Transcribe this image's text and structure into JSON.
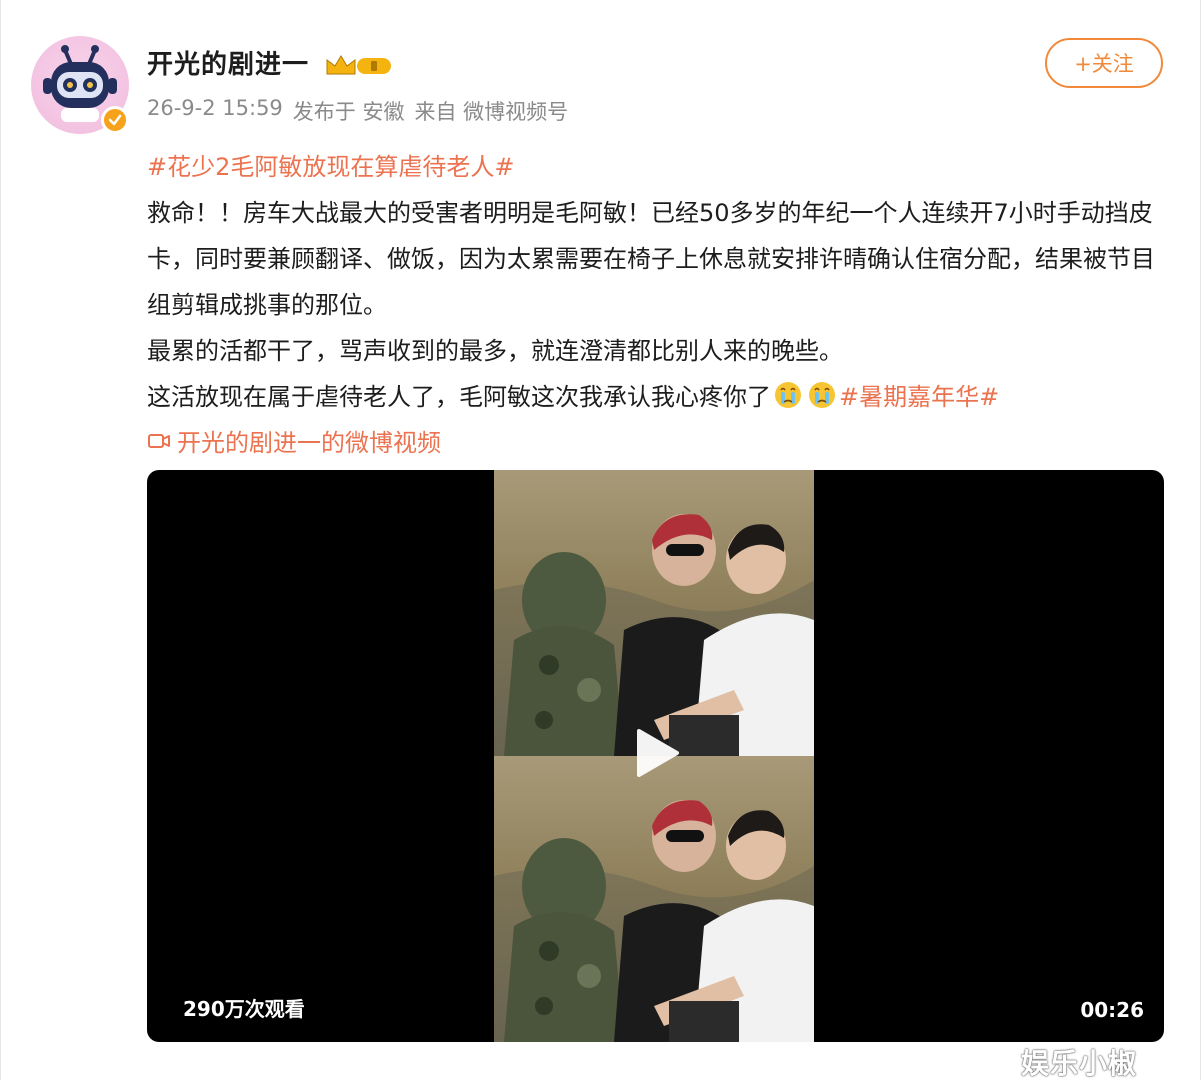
{
  "user": {
    "name": "开光的剧进一",
    "meta_time": "26-9-2 15:59",
    "meta_location": "发布于 安徽",
    "meta_source": "来自 微博视频号"
  },
  "follow_label": "+关注",
  "post": {
    "topic1": "#花少2毛阿敏放现在算虐待老人#",
    "line1": "救命！！房车大战最大的受害者明明是毛阿敏！已经50多岁的年纪一个人连续开7小时手动挡皮卡，同时要兼顾翻译、做饭，因为太累需要在椅子上休息就安排许晴确认住宿分配，结果被节目组剪辑成挑事的那位。",
    "line2": "最累的活都干了，骂声收到的最多，就连澄清都比别人来的晚些。",
    "line3": "这活放现在属于虐待老人了，毛阿敏这次我承认我心疼你了",
    "topic2": "#暑期嘉年华#",
    "video_link": "开光的剧进一的微博视频"
  },
  "video": {
    "views": "290万次观看",
    "duration": "00:26"
  },
  "watermark": "娱乐小椒",
  "icons": {
    "verified": "verified-badge-icon",
    "crown": "crown-icon",
    "emoji": "crying-emoji-icon",
    "video": "video-camera-icon",
    "play": "play-icon"
  },
  "colors": {
    "accent": "#eb7350",
    "follow": "#f08a3a",
    "verified": "#f7a21b"
  }
}
